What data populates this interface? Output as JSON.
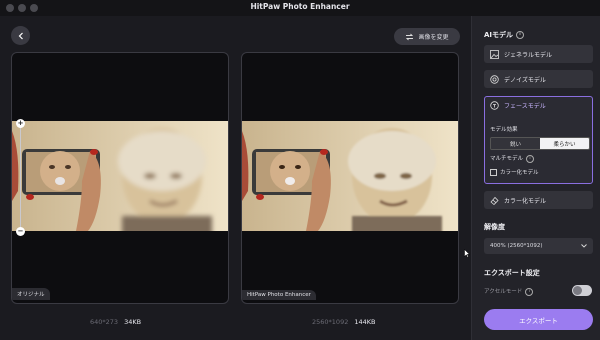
{
  "window": {
    "title": "HitPaw Photo Enhancer"
  },
  "toolbar": {
    "change_image_label": "画像を変更"
  },
  "preview": {
    "left": {
      "label": "オリジナル",
      "resolution": "640*273",
      "size": "34KB"
    },
    "right": {
      "label": "HitPaw Photo Enhancer",
      "resolution": "2560*1092",
      "size": "144KB"
    }
  },
  "sidebar": {
    "ai_model_heading": "AIモデル",
    "models": [
      {
        "label": "ジェネラルモデル",
        "icon": "image-icon"
      },
      {
        "label": "デノイズモデル",
        "icon": "denoise-icon"
      },
      {
        "label": "フェースモデル",
        "icon": "face-icon",
        "selected": true
      }
    ],
    "face_options": {
      "effect_label": "モデル効果",
      "options": [
        "鋭い",
        "柔らかい"
      ],
      "selected": "柔らかい",
      "multi_label": "マルチモデル",
      "colorize_checkbox": "カラー化モデル"
    },
    "colorize_model": {
      "label": "カラー化モデル",
      "icon": "eraser-icon"
    },
    "resolution_heading": "解像度",
    "resolution_value": "400% (2560*1092)",
    "export_heading": "エクスポート設定",
    "accel_label": "アクセルモード",
    "export_button": "エクスポート"
  },
  "colors": {
    "accent": "#9b7cf0",
    "background": "#1b1b20",
    "sidebar": "#232329"
  }
}
